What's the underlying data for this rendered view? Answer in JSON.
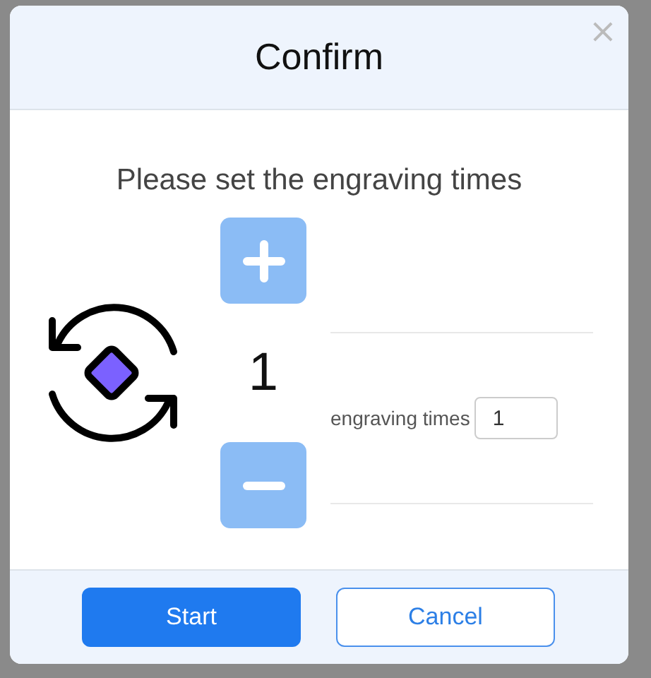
{
  "dialog": {
    "title": "Confirm",
    "close": "×"
  },
  "prompt": "Please set the engraving times",
  "counter": {
    "value": "1"
  },
  "field": {
    "label": "engraving times",
    "value": "1"
  },
  "buttons": [
    {
      "label": "Start",
      "kind": "primary"
    },
    {
      "label": "Cancel",
      "kind": "secondary"
    }
  ]
}
